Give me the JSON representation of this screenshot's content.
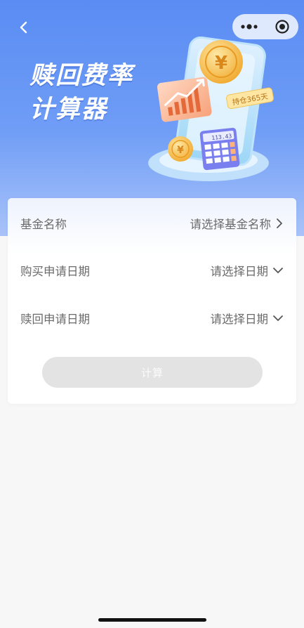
{
  "hero": {
    "title_line1": "赎回费率",
    "title_line2": "计算器",
    "tag": "持仓365天",
    "calc_display": "113.43",
    "coin_symbol": "¥"
  },
  "form": {
    "fund_name": {
      "label": "基金名称",
      "value": "请选择基金名称",
      "icon": "chevron-right-icon"
    },
    "buy_date": {
      "label": "购买申请日期",
      "value": "请选择日期",
      "icon": "chevron-down-icon"
    },
    "redeem_date": {
      "label": "赎回申请日期",
      "value": "请选择日期",
      "icon": "chevron-down-icon"
    },
    "calculate_label": "计算"
  },
  "colors": {
    "hero_gradient_top": "#5a8cf3",
    "accent_coin": "#f5b73b",
    "disabled_button": "#e3e3e3",
    "label_text": "#6b6b6b"
  }
}
